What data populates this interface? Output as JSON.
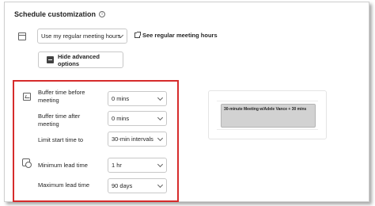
{
  "header": {
    "title": "Schedule customization",
    "info_glyph": "i"
  },
  "meeting_hours": {
    "selected": "Use my regular meeting hours",
    "link_label": "See regular meeting hours"
  },
  "advanced": {
    "button_label": "Hide advanced options"
  },
  "fields": {
    "buffer_before": {
      "label_line1": "Buffer time before",
      "label_line2": "meeting",
      "value": "0 mins"
    },
    "buffer_after": {
      "label_line1": "Buffer time after",
      "label_line2": "meeting",
      "value": "0 mins"
    },
    "limit_start": {
      "label": "Limit start time to",
      "value": "30-min intervals"
    },
    "min_lead": {
      "label": "Minimum lead time",
      "value": "1 hr"
    },
    "max_lead": {
      "label": "Maximum lead time",
      "value": "90 days"
    }
  },
  "preview": {
    "event_text": "30-minute Meeting w/Adele Vance + 30 mins"
  },
  "colors": {
    "highlight": "#d62b2b",
    "event_block": "#d2d2d2"
  },
  "icons": [
    "info-icon",
    "calendar-icon",
    "external-link-icon",
    "collapse-icon",
    "buffer-icon",
    "lead-time-icon",
    "chevron-down-icon"
  ]
}
